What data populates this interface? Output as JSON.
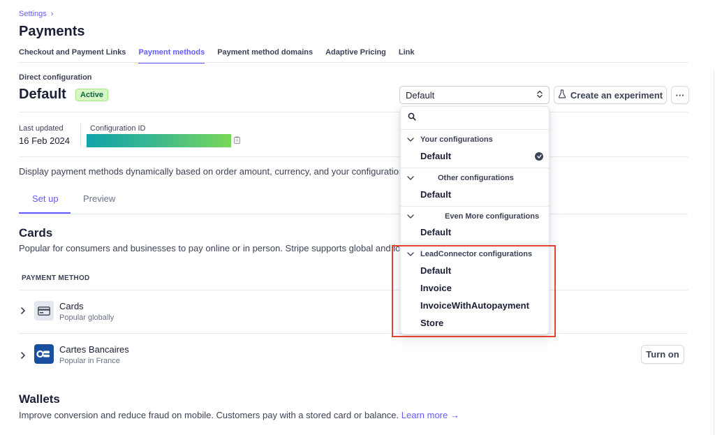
{
  "breadcrumb": {
    "parent": "Settings",
    "chevron": "›"
  },
  "page_title": "Payments",
  "tabs": [
    {
      "label": "Checkout and Payment Links",
      "active": false
    },
    {
      "label": "Payment methods",
      "active": true
    },
    {
      "label": "Payment method domains",
      "active": false
    },
    {
      "label": "Adaptive Pricing",
      "active": false
    },
    {
      "label": "Link",
      "active": false
    }
  ],
  "config": {
    "section_label": "Direct configuration",
    "title": "Default",
    "status_badge": "Active",
    "select_value": "Default",
    "select_icon": "up-down-chevron-icon",
    "experiment_button": "Create an experiment",
    "experiment_icon": "flask-icon",
    "more_button": "···"
  },
  "meta": {
    "updated_label": "Last updated",
    "updated_value": "16 Feb 2024",
    "config_id_label": "Configuration ID",
    "copy_icon": "clipboard-icon"
  },
  "description": "Display payment methods dynamically based on order amount, currency, and your configuration",
  "subtabs": {
    "setup": "Set up",
    "preview": "Preview"
  },
  "cards_section": {
    "heading": "Cards",
    "description": "Popular for consumers and businesses to pay online or in person. Stripe supports global and lo",
    "column_header": "PAYMENT METHOD",
    "rows": [
      {
        "name": "Cards",
        "sub": "Popular globally",
        "icon": "card-icon"
      },
      {
        "name": "Cartes Bancaires",
        "sub": "Popular in France",
        "icon": "cartes-bancaires-logo",
        "action": "Turn on"
      }
    ]
  },
  "wallets_section": {
    "heading": "Wallets",
    "description": "Improve conversion and reduce fraud on mobile. Customers pay with a stored card or balance.",
    "learn_more": "Learn more →"
  },
  "dropdown": {
    "search_icon": "search-icon",
    "groups": [
      {
        "label": "Your configurations",
        "items": [
          "Default"
        ],
        "selected": "Default"
      },
      {
        "label": "Other configurations",
        "items": [
          "Default"
        ]
      },
      {
        "label": "Even More configurations",
        "items": [
          "Default"
        ]
      },
      {
        "label": "LeadConnector configurations",
        "items": [
          "Default",
          "Invoice",
          "InvoiceWithAutopayment",
          "Store"
        ]
      }
    ]
  },
  "colors": {
    "accent": "#635bff",
    "badge_bg": "#d7f7c2",
    "highlight": "#e5432d"
  }
}
